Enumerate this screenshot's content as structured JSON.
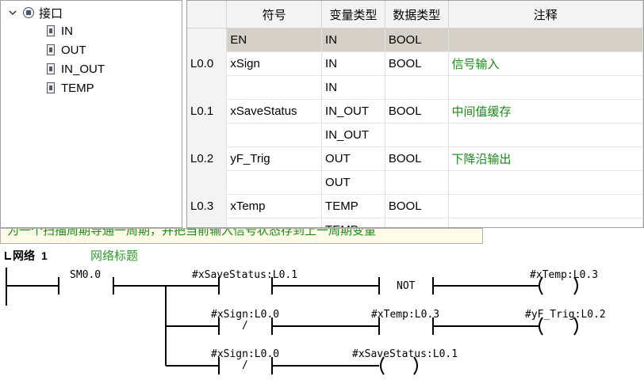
{
  "tree": {
    "root": "接口",
    "items": [
      "IN",
      "OUT",
      "IN_OUT",
      "TEMP"
    ]
  },
  "table": {
    "headers": [
      "符号",
      "变量类型",
      "数据类型",
      "注释"
    ],
    "rows": [
      {
        "addr": "",
        "symbol": "EN",
        "vartype": "IN",
        "datatype": "BOOL",
        "comment": ""
      },
      {
        "addr": "L0.0",
        "symbol": "xSign",
        "vartype": "IN",
        "datatype": "BOOL",
        "comment": "信号输入"
      },
      {
        "addr": "",
        "symbol": "",
        "vartype": "IN",
        "datatype": "",
        "comment": ""
      },
      {
        "addr": "L0.1",
        "symbol": "xSaveStatus",
        "vartype": "IN_OUT",
        "datatype": "BOOL",
        "comment": "中间值缓存"
      },
      {
        "addr": "",
        "symbol": "",
        "vartype": "IN_OUT",
        "datatype": "",
        "comment": ""
      },
      {
        "addr": "L0.2",
        "symbol": "yF_Trig",
        "vartype": "OUT",
        "datatype": "BOOL",
        "comment": "下降沿输出"
      },
      {
        "addr": "",
        "symbol": "",
        "vartype": "OUT",
        "datatype": "",
        "comment": ""
      },
      {
        "addr": "L0.3",
        "symbol": "xTemp",
        "vartype": "TEMP",
        "datatype": "BOOL",
        "comment": ""
      },
      {
        "addr": "",
        "symbol": "",
        "vartype": "TEMP",
        "datatype": "",
        "comment": ""
      }
    ]
  },
  "titlebar": {
    "text": "为一个扫描周期导通一周期，并把当前输入信号状态存到上一周期变量"
  },
  "network": {
    "label": "网络",
    "number": "1",
    "title": "网络标题"
  },
  "ladder": {
    "sm": "SM0.0",
    "rung1": {
      "contact": "#xSaveStatus:L0.1",
      "not": "NOT",
      "coil": "#xTemp:L0.3"
    },
    "rung2": {
      "contact1": "#xSign:L0.0",
      "contact1_mark": "/",
      "contact2": "#xTemp:L0.3",
      "coil": "#yF_Trig:L0.2"
    },
    "rung3": {
      "contact": "#xSign:L0.0",
      "contact_mark": "/",
      "coil": "#xSaveStatus:L0.1"
    }
  }
}
